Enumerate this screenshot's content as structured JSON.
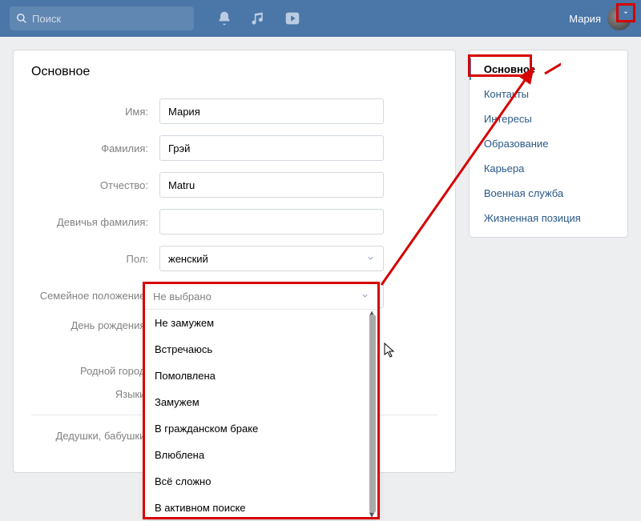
{
  "topbar": {
    "search_placeholder": "Поиск",
    "user_name": "Мария"
  },
  "main": {
    "title": "Основное",
    "labels": {
      "first_name": "Имя:",
      "last_name": "Фамилия:",
      "middle_name": "Отчество:",
      "maiden_name": "Девичья фамилия:",
      "sex": "Пол:",
      "marital": "Семейное положение:",
      "birthday": "День рождения:",
      "hometown": "Родной город:",
      "languages": "Языки:",
      "grandparents": "Дедушки, бабушки:"
    },
    "values": {
      "first_name": "Мария",
      "last_name": "Грэй",
      "middle_name": "Matru",
      "maiden_name": "",
      "sex": "женский",
      "marital_selected": "Не выбрано"
    },
    "marital_options": [
      "Не замужем",
      "Встречаюсь",
      "Помолвлена",
      "Замужем",
      "В гражданском браке",
      "Влюблена",
      "Всё сложно",
      "В активном поиске"
    ]
  },
  "sidebar": {
    "items": [
      "Основное",
      "Контакты",
      "Интересы",
      "Образование",
      "Карьера",
      "Военная служба",
      "Жизненная позиция"
    ]
  }
}
